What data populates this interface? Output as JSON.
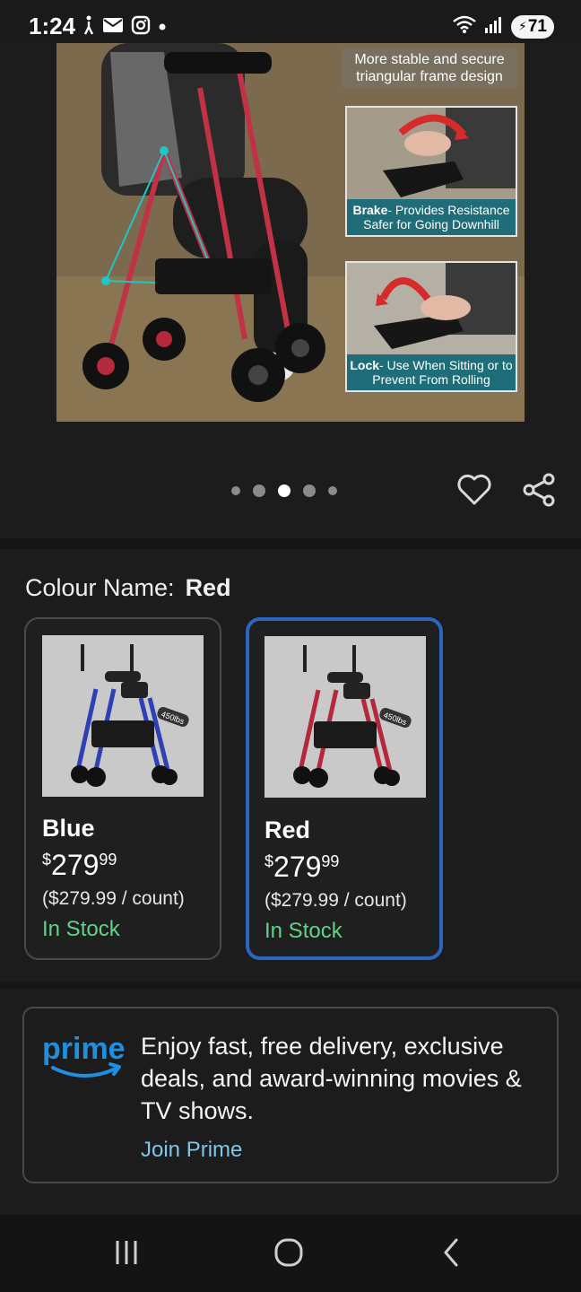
{
  "status_bar": {
    "time": "1:24",
    "left_icons": [
      "accessibility-icon",
      "mail-icon",
      "instagram-icon",
      "dot-icon"
    ],
    "right_icons": [
      "wifi-icon",
      "signal-icon"
    ],
    "battery": "71"
  },
  "hero": {
    "caption_top": "More stable and secure triangular frame design",
    "brake_title": "Brake",
    "brake_text": "- Provides Resistance Safer for Going Downhill",
    "lock_title": "Lock",
    "lock_text": "- Use When Sitting or to Prevent From Rolling"
  },
  "carousel": {
    "dot_count": 5,
    "active_index": 2
  },
  "colour": {
    "label": "Colour Name:",
    "selected": "Red",
    "options": [
      {
        "name": "Blue",
        "currency": "$",
        "whole": "279",
        "fraction": "99",
        "unit_price": "($279.99 / count)",
        "stock": "In Stock",
        "badge": "450lbs",
        "frame_color": "#2f3fb5"
      },
      {
        "name": "Red",
        "currency": "$",
        "whole": "279",
        "fraction": "99",
        "unit_price": "($279.99 / count)",
        "stock": "In Stock",
        "badge": "450lbs",
        "frame_color": "#b5273a"
      }
    ]
  },
  "prime": {
    "logo_text": "prime",
    "text": "Enjoy fast, free delivery, exclusive deals, and award-winning movies & TV shows.",
    "link": "Join Prime"
  },
  "colors": {
    "accent_blue": "#2d65c2",
    "stock_green": "#5fd38a",
    "link_blue": "#7ec6ea",
    "prime_blue": "#1f8fe0"
  }
}
